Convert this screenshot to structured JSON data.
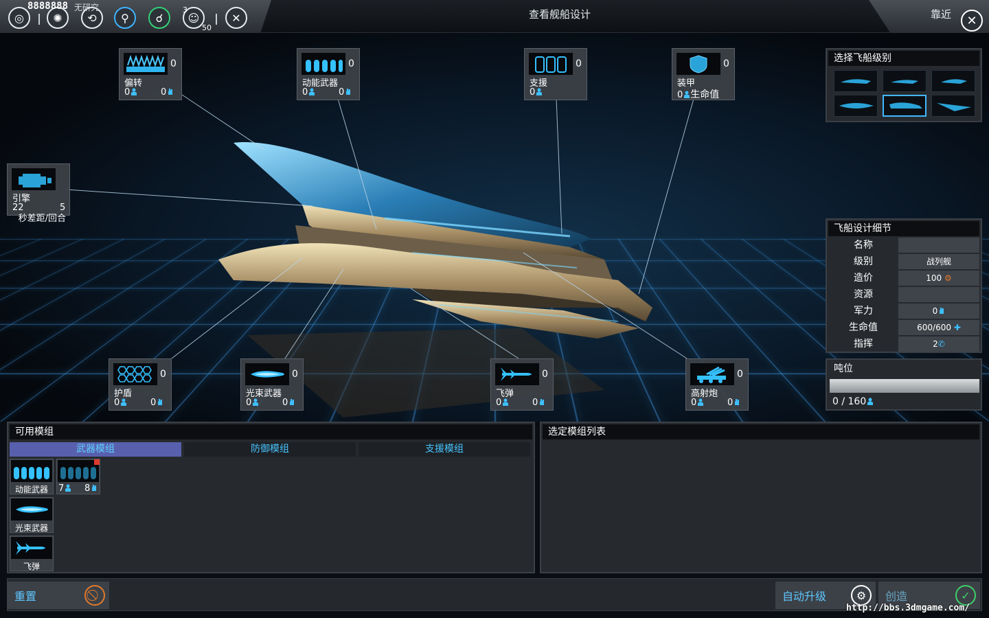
{
  "topbar": {
    "counter": "8888888",
    "counter_note": "无研究",
    "badge_top": "3",
    "badge_bottom": "50",
    "title": "查看舰船设计",
    "zoom_label": "靠近",
    "close_icon": "close-icon"
  },
  "slots": {
    "deflector": {
      "name": "偏转",
      "count": "0",
      "v1": "0",
      "v2": "0"
    },
    "kinetic": {
      "name": "动能武器",
      "count": "0",
      "v1": "0",
      "v2": "0"
    },
    "support": {
      "name": "支援",
      "count": "0",
      "v1": "0"
    },
    "armor": {
      "name": "装甲",
      "count": "0",
      "v1": "0",
      "v1_suffix": "生命值"
    },
    "engine": {
      "name": "引擎",
      "v1": "22",
      "v2": "5",
      "extra": "秒差距/回合"
    },
    "shield": {
      "name": "护盾",
      "count": "0",
      "v1": "0",
      "v2": "0"
    },
    "beam": {
      "name": "光束武器",
      "count": "0",
      "v1": "0",
      "v2": "0"
    },
    "missile": {
      "name": "飞弹",
      "count": "0",
      "v1": "0",
      "v2": "0"
    },
    "flak": {
      "name": "高射炮",
      "count": "0",
      "v1": "0",
      "v2": "0"
    }
  },
  "class_panel": {
    "title": "选择飞船级别",
    "selected_index": 4
  },
  "detail_panel": {
    "title": "飞船设计细节",
    "rows": [
      {
        "key": "名称",
        "value": ""
      },
      {
        "key": "级别",
        "value": "战列舰"
      },
      {
        "key": "造价",
        "value": "100"
      },
      {
        "key": "资源",
        "value": ""
      },
      {
        "key": "军力",
        "value": "0"
      },
      {
        "key": "生命值",
        "value": "600/600"
      },
      {
        "key": "指挥",
        "value": "2"
      }
    ]
  },
  "tonnage": {
    "title": "吨位",
    "text": "0 / 160",
    "fill": 0
  },
  "available": {
    "title": "可用模组",
    "tabs": [
      "武器模组",
      "防御模组",
      "支援模组"
    ],
    "active_tab": 0,
    "modules": [
      {
        "label": "动能武器"
      },
      {
        "label_a": "7",
        "label_b": "8"
      },
      {
        "label": "光束武器"
      },
      {
        "label": "飞弹"
      }
    ]
  },
  "selected_list": {
    "title": "选定模组列表"
  },
  "footer": {
    "reset": "重置",
    "auto_upgrade": "自动升级",
    "create": "创造"
  },
  "watermark": "http://bbs.3dmgame.com/",
  "colors": {
    "accent": "#42b8ff",
    "tab_active": "#5860ae",
    "orange": "#e27a2c",
    "green": "#3fd06a"
  }
}
